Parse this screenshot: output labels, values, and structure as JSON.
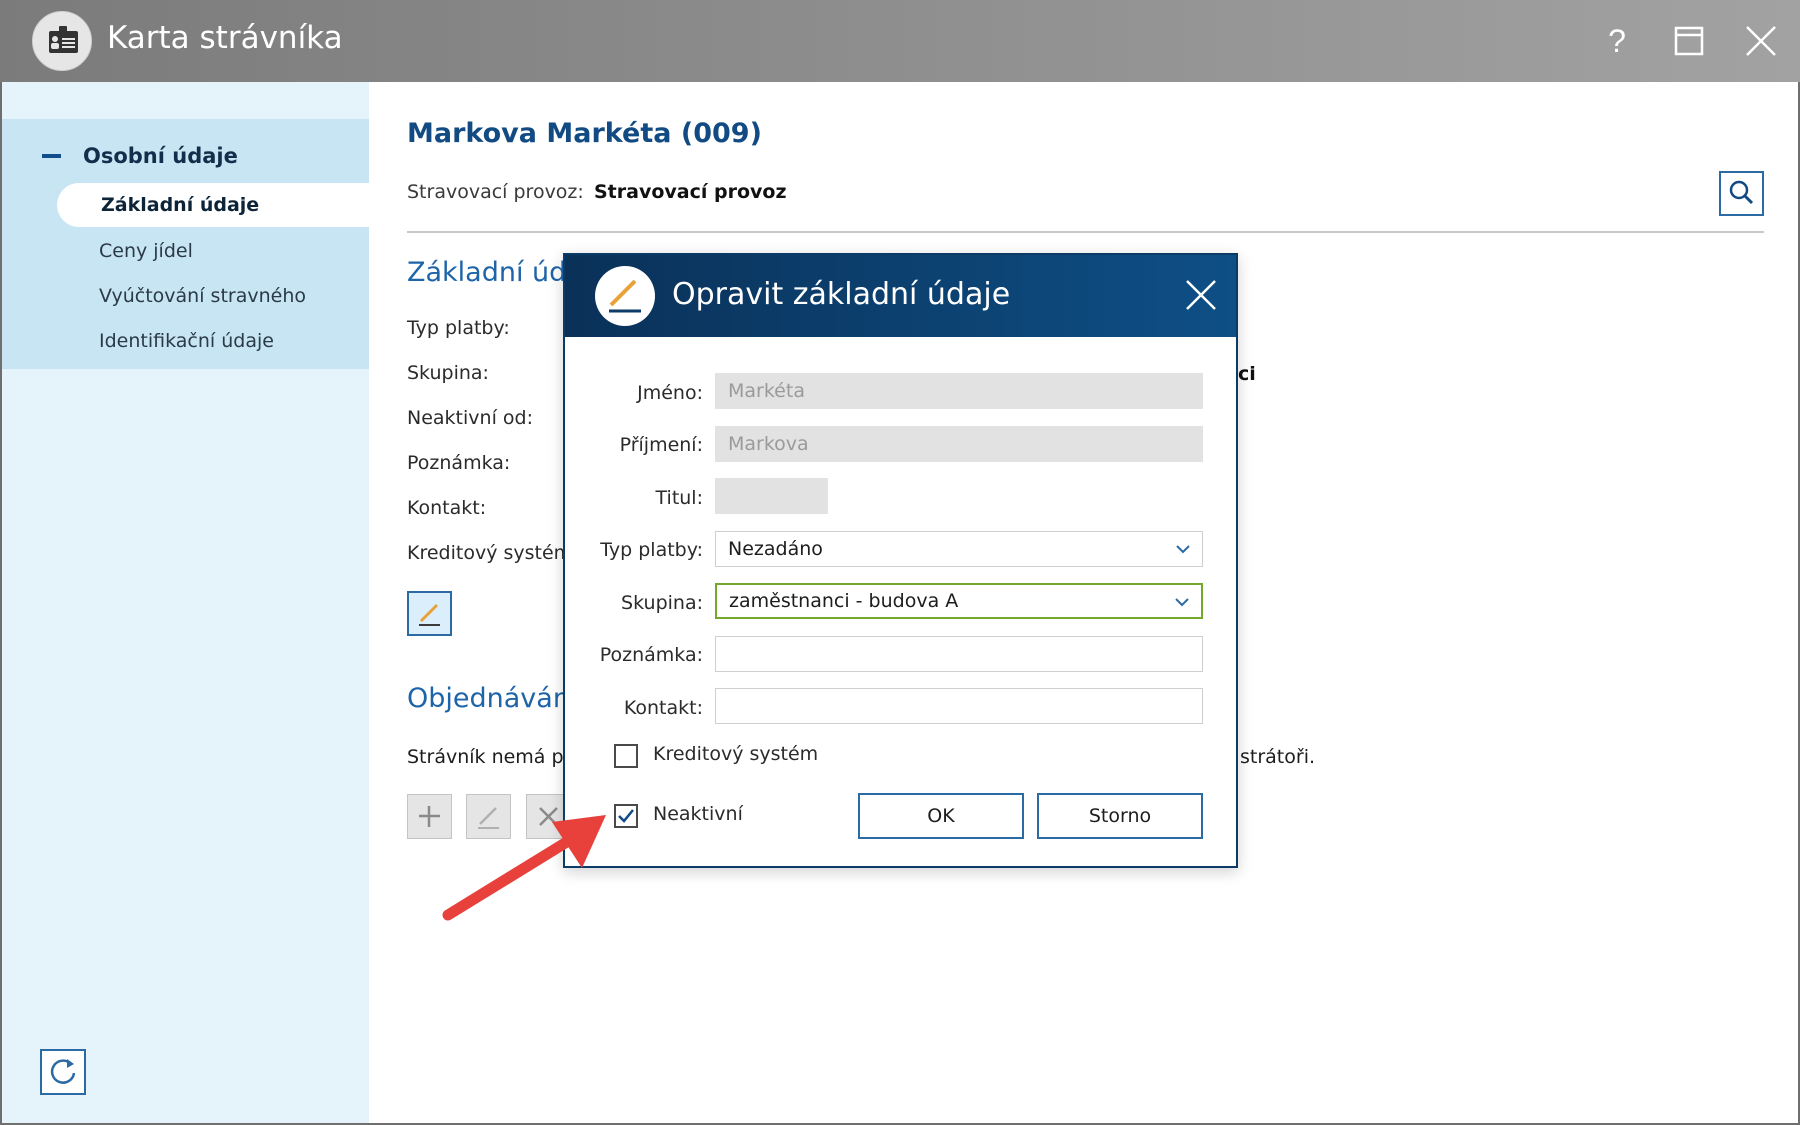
{
  "window": {
    "title": "Karta strávníka"
  },
  "sidebar": {
    "section_label": "Osobní údaje",
    "items": [
      {
        "label": "Základní údaje",
        "active": true
      },
      {
        "label": "Ceny jídel"
      },
      {
        "label": "Vyúčtování stravného"
      },
      {
        "label": "Identifikační údaje"
      }
    ]
  },
  "main": {
    "person_name": "Markova Markéta (009)",
    "provoz_label": "Stravovací provoz:",
    "provoz_value": "Stravovací provoz",
    "section_basic": "Základní úda",
    "fields": [
      {
        "label": "Typ platby:"
      },
      {
        "label": "Skupina:"
      },
      {
        "label": "Neaktivní od:"
      },
      {
        "label": "Poznámka:"
      },
      {
        "label": "Kontakt:"
      },
      {
        "label": "Kreditový systém"
      }
    ],
    "group_value_tail": "ci",
    "section_orders": "Objednáván",
    "orders_text_start": "Strávník nemá pra",
    "orders_text_end": "strátoři."
  },
  "dialog": {
    "title": "Opravit základní údaje",
    "fields": {
      "jmeno": {
        "label": "Jméno:",
        "value": "Markéta"
      },
      "prijmeni": {
        "label": "Příjmení:",
        "value": "Markova"
      },
      "titul": {
        "label": "Titul:",
        "value": ""
      },
      "typ_platby": {
        "label": "Typ platby:",
        "value": "Nezadáno"
      },
      "skupina": {
        "label": "Skupina:",
        "value": "zaměstnanci - budova A"
      },
      "poznamka": {
        "label": "Poznámka:",
        "value": ""
      },
      "kontakt": {
        "label": "Kontakt:",
        "value": ""
      }
    },
    "kredit_label": "Kreditový systém",
    "kredit_checked": false,
    "neaktivni_label": "Neaktivní",
    "neaktivni_checked": true,
    "ok_label": "OK",
    "storno_label": "Storno"
  },
  "colors": {
    "accent": "#1e64a8",
    "dialog_header": "#0b3b66",
    "annotation_arrow": "#e8413c",
    "valid_border": "#74a82b"
  }
}
